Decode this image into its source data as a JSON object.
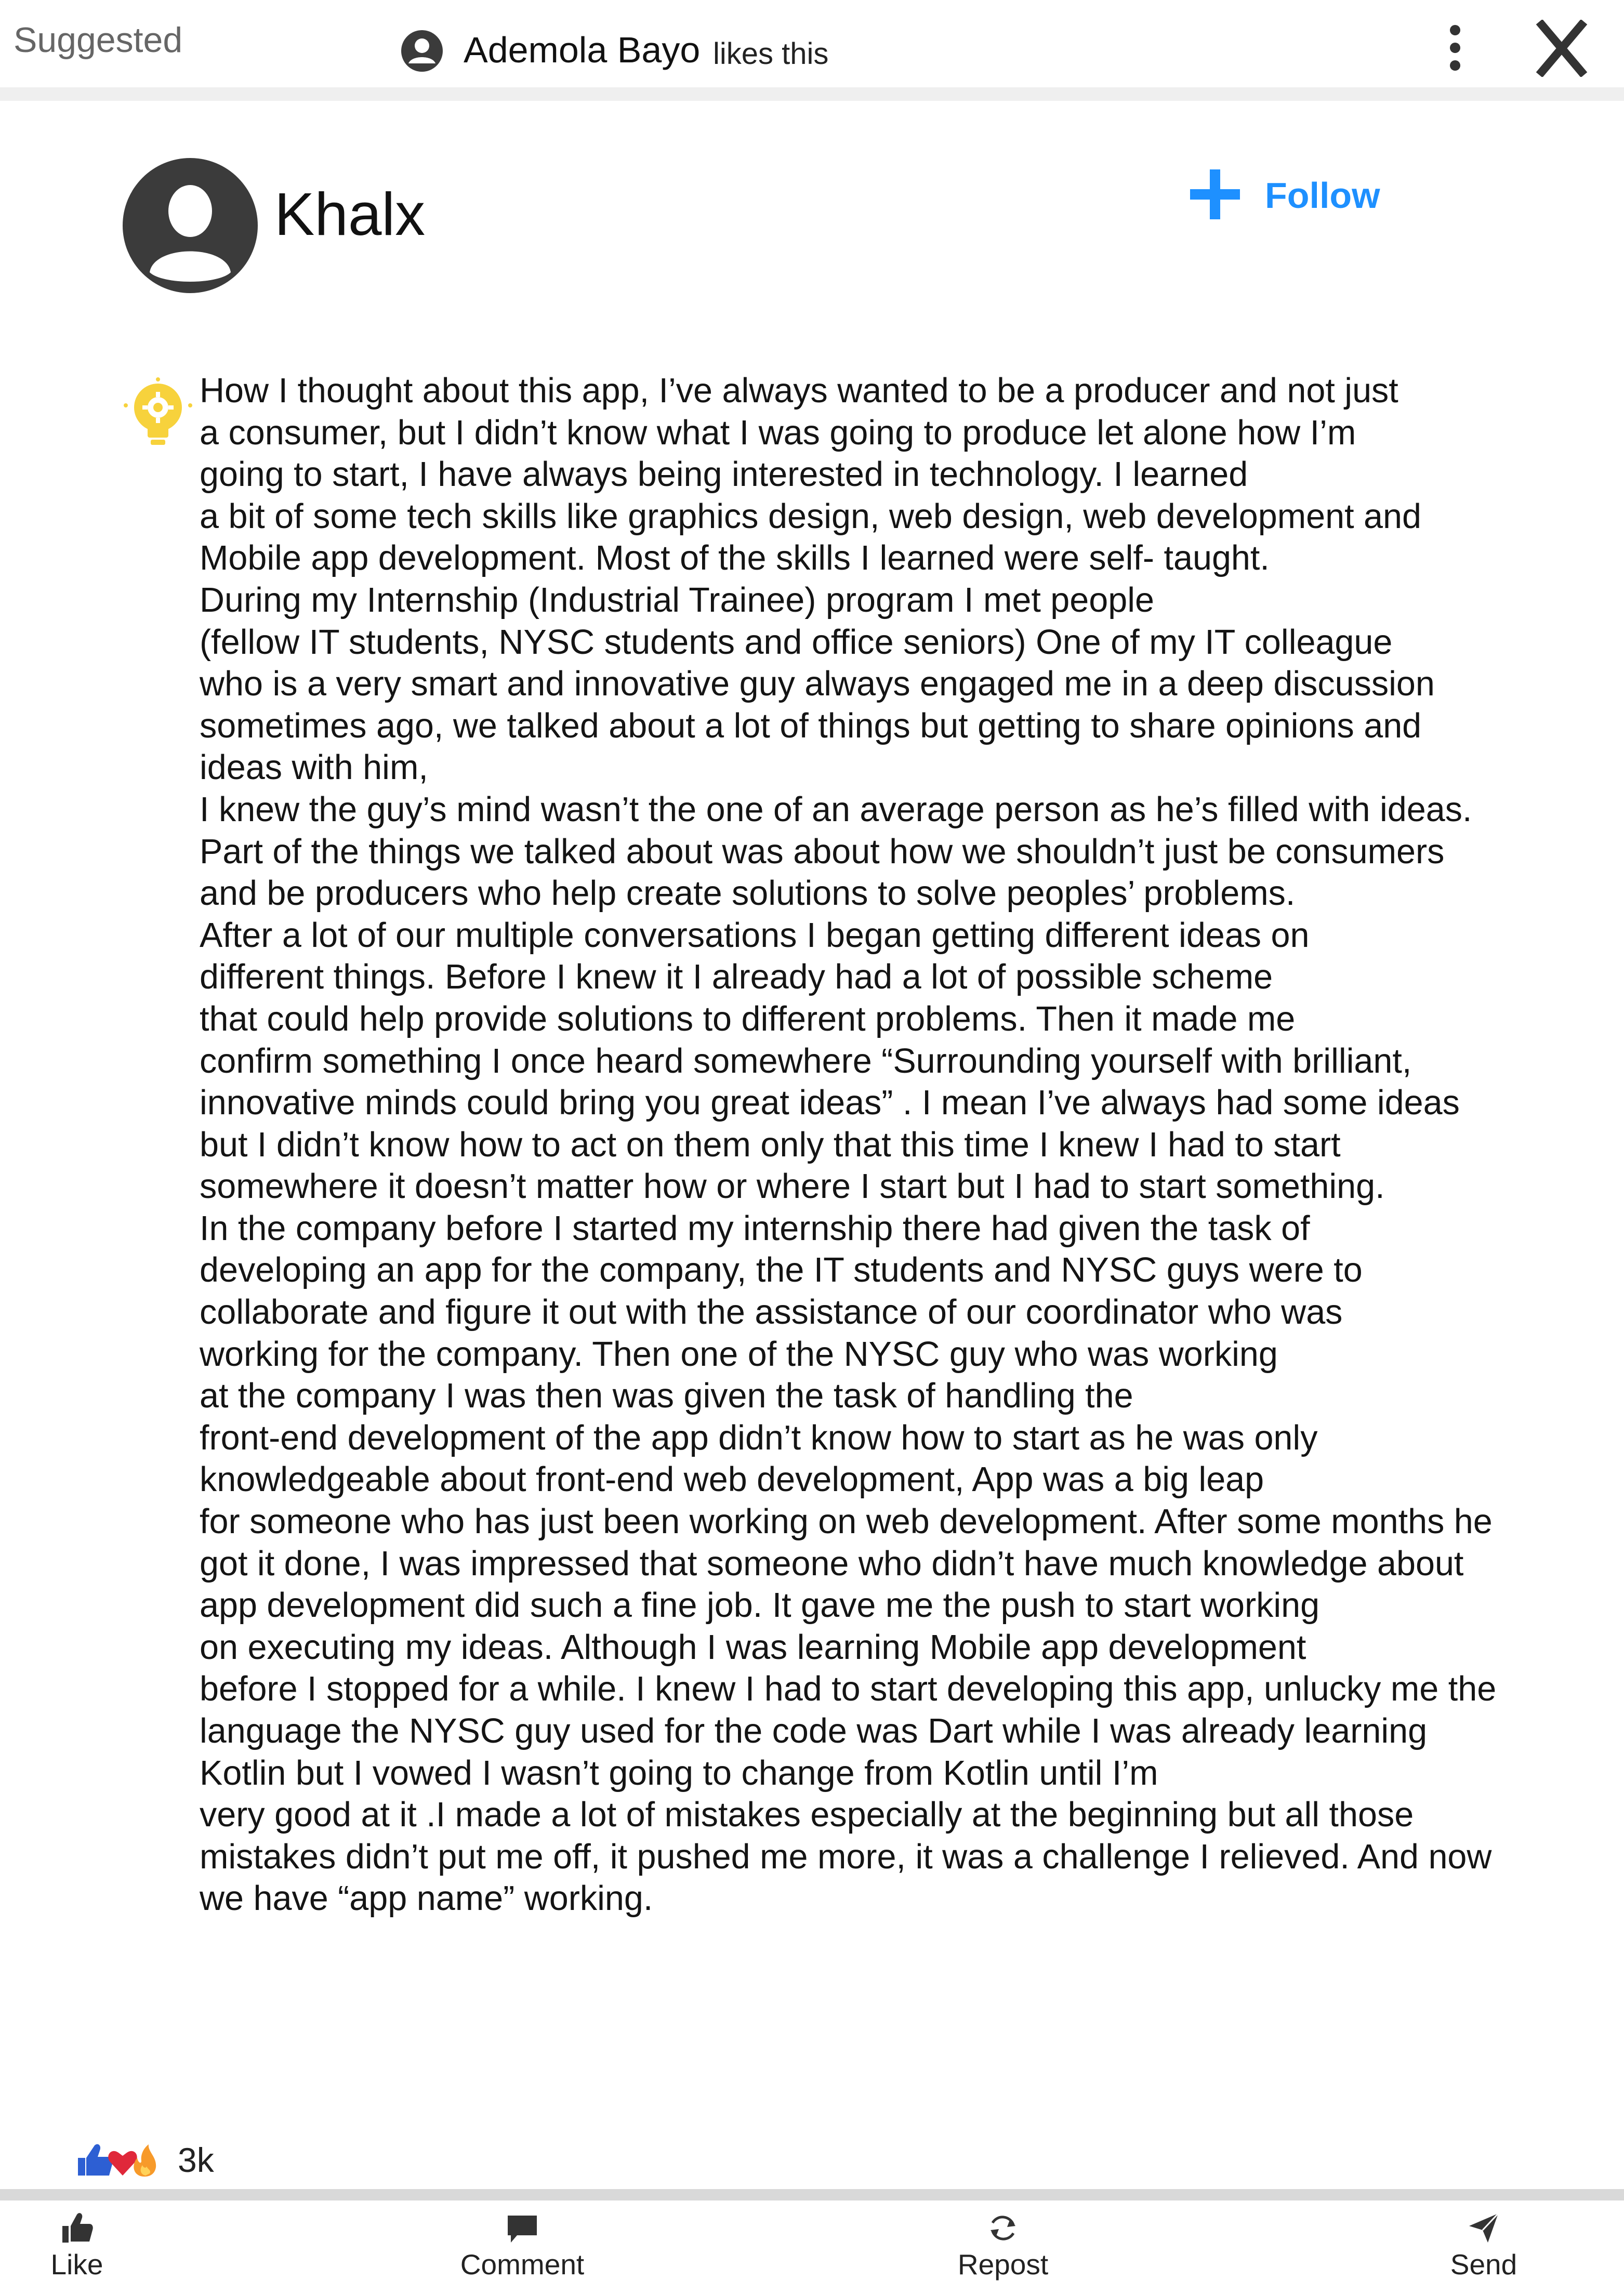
{
  "header": {
    "suggested_label": "Suggested",
    "liker_name": "Ademola Bayo",
    "liker_action": "likes this",
    "more_icon": "more-vertical-icon",
    "close_label": "X"
  },
  "author": {
    "name": "Khalx",
    "avatar_icon": "user-avatar-icon",
    "follow_label": "Follow",
    "follow_icon": "plus-icon"
  },
  "post": {
    "icon": "lightbulb-gear-icon",
    "lines": [
      "How I thought about this app, I’ve always wanted to be a producer and not just",
      "a consumer, but I didn’t know what I was going to produce let alone how I’m",
      "going to start, I have always being interested in technology. I learned",
      "a bit of some tech skills like graphics design, web design, web development and",
      "Mobile app development. Most of the skills I learned were self- taught.",
      "During my Internship (Industrial Trainee) program I met people",
      "(fellow IT students, NYSC students and office seniors) One of my IT colleague",
      "who is a very smart and innovative guy always engaged me in a deep discussion",
      "sometimes ago, we talked about a lot of things but getting to share opinions and",
      "ideas with him,",
      "I knew the guy’s mind wasn’t the one of an average person as he’s filled with ideas.",
      "Part of the things we talked about was about how we shouldn’t just be consumers",
      "and be producers who help create solutions to solve peoples’ problems.",
      "After a lot of our multiple conversations I began getting different ideas on",
      "different things. Before I knew it I already had a lot of possible scheme",
      "that could help provide solutions to different  problems. Then it made me",
      "confirm something I once heard somewhere “Surrounding yourself with brilliant,",
      "innovative minds could bring you great ideas” . I mean I’ve always had some ideas",
      "but I didn’t know how to act on them only that this time I knew I had to start",
      "somewhere it doesn’t matter how or where I start but I had to start something.",
      "In the company before I started my internship there had given the task of",
      "developing an app for the company, the IT students and NYSC guys were to",
      "collaborate and figure it out with the assistance of our coordinator who was",
      "working for the company. Then one of the NYSC guy who was working",
      "at  the company I was then was given the task of handling the",
      "front-end development of the app didn’t know how to start as he was only",
      "knowledgeable about front-end web development, App was a big leap",
      "for someone who has just been working on web development. After some months he",
      "got it done, I was impressed that someone who didn’t have much knowledge about",
      "app development did such a fine job. It gave me the push to start working",
      "on executing my ideas. Although I was learning Mobile app development",
      "before I stopped for a while. I knew I had to start developing this app, unlucky me the",
      "language the NYSC guy used for the code was Dart while I was already learning",
      "Kotlin but I vowed I wasn’t going to change from Kotlin until I’m",
      "very  good at it .I made a lot of mistakes especially at the beginning but all those",
      "mistakes didn’t put me off, it pushed me more, it was a challenge I relieved.  And now",
      "we have “app name” working."
    ]
  },
  "reactions": {
    "icons": [
      "thumbs-up-icon",
      "heart-icon",
      "fire-icon"
    ],
    "count": "3k"
  },
  "actions": {
    "like": "Like",
    "comment": "Comment",
    "repost": "Repost",
    "send": "Send"
  },
  "colors": {
    "accent": "#1e90ff",
    "bulb": "#f7d23c",
    "avatar": "#3b3b3b"
  }
}
